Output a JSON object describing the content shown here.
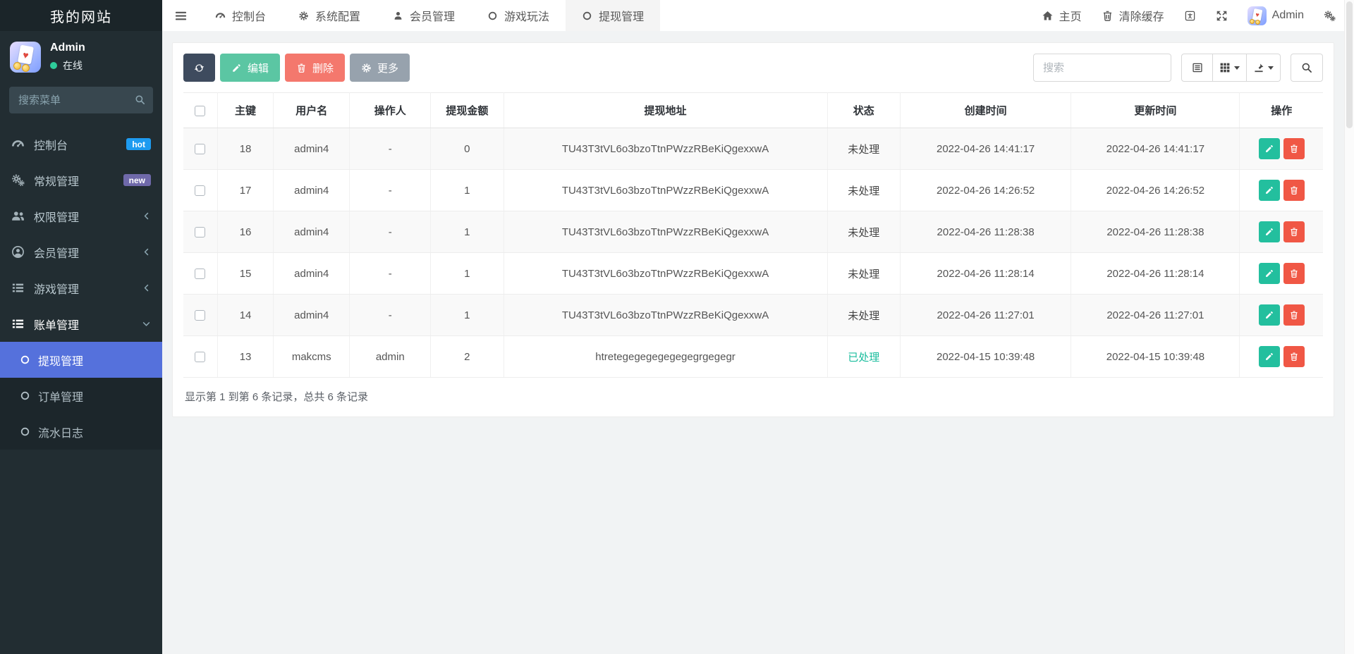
{
  "app": {
    "title": "我的网站"
  },
  "sidebar": {
    "user": {
      "name": "Admin",
      "status": "在线"
    },
    "search_placeholder": "搜索菜单",
    "menu": [
      {
        "key": "dashboard",
        "icon": "gauge",
        "label": "控制台",
        "badge": "hot"
      },
      {
        "key": "general",
        "icon": "cogs",
        "label": "常规管理",
        "badge": "new"
      },
      {
        "key": "permission",
        "icon": "users",
        "label": "权限管理",
        "chevron": "left"
      },
      {
        "key": "member",
        "icon": "user-circle",
        "label": "会员管理",
        "chevron": "left"
      },
      {
        "key": "game",
        "icon": "list",
        "label": "游戏管理",
        "chevron": "left"
      },
      {
        "key": "billing",
        "icon": "list",
        "label": "账单管理",
        "chevron": "down",
        "active": true
      }
    ],
    "submenu": [
      {
        "key": "withdraw",
        "label": "提现管理",
        "active": true
      },
      {
        "key": "order",
        "label": "订单管理"
      },
      {
        "key": "flow",
        "label": "流水日志"
      }
    ]
  },
  "navbar": {
    "tabs": [
      {
        "key": "dashboard",
        "icon": "gauge",
        "label": "控制台"
      },
      {
        "key": "system-config",
        "icon": "gear",
        "label": "系统配置"
      },
      {
        "key": "member",
        "icon": "user",
        "label": "会员管理"
      },
      {
        "key": "gameplay",
        "icon": "circle",
        "label": "游戏玩法"
      },
      {
        "key": "withdraw",
        "icon": "circle",
        "label": "提现管理",
        "active": true
      }
    ],
    "home_label": "主页",
    "clear_cache_label": "清除缓存",
    "username": "Admin"
  },
  "toolbar": {
    "edit_label": "编辑",
    "delete_label": "删除",
    "more_label": "更多",
    "search_placeholder": "搜索"
  },
  "table": {
    "columns": [
      "主键",
      "用户名",
      "操作人",
      "提现金额",
      "提现地址",
      "状态",
      "创建时间",
      "更新时间",
      "操作"
    ],
    "rows": [
      {
        "id": "18",
        "username": "admin4",
        "operator": "-",
        "amount": "0",
        "address": "TU43T3tVL6o3bzoTtnPWzzRBeKiQgexxwA",
        "status": "未处理",
        "status_type": "pending",
        "created": "2022-04-26 14:41:17",
        "updated": "2022-04-26 14:41:17"
      },
      {
        "id": "17",
        "username": "admin4",
        "operator": "-",
        "amount": "1",
        "address": "TU43T3tVL6o3bzoTtnPWzzRBeKiQgexxwA",
        "status": "未处理",
        "status_type": "pending",
        "created": "2022-04-26 14:26:52",
        "updated": "2022-04-26 14:26:52"
      },
      {
        "id": "16",
        "username": "admin4",
        "operator": "-",
        "amount": "1",
        "address": "TU43T3tVL6o3bzoTtnPWzzRBeKiQgexxwA",
        "status": "未处理",
        "status_type": "pending",
        "created": "2022-04-26 11:28:38",
        "updated": "2022-04-26 11:28:38"
      },
      {
        "id": "15",
        "username": "admin4",
        "operator": "-",
        "amount": "1",
        "address": "TU43T3tVL6o3bzoTtnPWzzRBeKiQgexxwA",
        "status": "未处理",
        "status_type": "pending",
        "created": "2022-04-26 11:28:14",
        "updated": "2022-04-26 11:28:14"
      },
      {
        "id": "14",
        "username": "admin4",
        "operator": "-",
        "amount": "1",
        "address": "TU43T3tVL6o3bzoTtnPWzzRBeKiQgexxwA",
        "status": "未处理",
        "status_type": "pending",
        "created": "2022-04-26 11:27:01",
        "updated": "2022-04-26 11:27:01"
      },
      {
        "id": "13",
        "username": "makcms",
        "operator": "admin",
        "amount": "2",
        "address": "htretegegegegegegegrgegegr",
        "status": "已处理",
        "status_type": "done",
        "created": "2022-04-15 10:39:48",
        "updated": "2022-04-15 10:39:48"
      }
    ],
    "footer": "显示第 1 到第 6 条记录，总共 6 条记录"
  },
  "colors": {
    "sidebar_active": "#5571dc",
    "badge_hot": "#1e9bf0",
    "badge_new": "#6f69aa",
    "btn_refresh": "#3e4b5e",
    "btn_edit": "#5bc6a3",
    "btn_delete": "#f4786d",
    "btn_more": "#97a2ad",
    "action_edit": "#23bf9e",
    "action_delete": "#f05745",
    "status_done": "#18bc9c",
    "online_dot": "#2ecc9a"
  }
}
